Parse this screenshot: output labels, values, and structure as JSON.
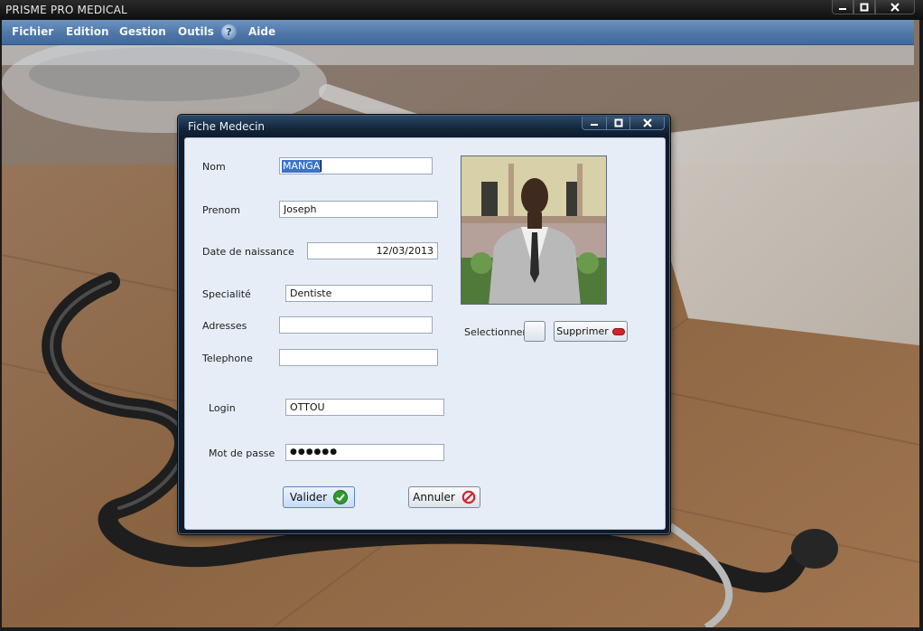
{
  "app": {
    "title": "PRISME PRO MEDICAL",
    "window_controls": [
      "minimize-icon",
      "maximize-icon",
      "close-icon"
    ]
  },
  "menu": {
    "items": [
      "Fichier",
      "Edition",
      "Gestion",
      "Outils",
      "Aide"
    ],
    "help_badge": "?"
  },
  "dialog": {
    "title": "Fiche Medecin",
    "fields": {
      "nom": {
        "label": "Nom",
        "value": "MANGA"
      },
      "prenom": {
        "label": "Prenom",
        "value": "Joseph"
      },
      "date_naissance": {
        "label": "Date de naissance",
        "value": "12/03/2013"
      },
      "specialite": {
        "label": "Specialité",
        "value": "Dentiste"
      },
      "adresses": {
        "label": "Adresses",
        "value": ""
      },
      "telephone": {
        "label": "Telephone",
        "value": ""
      },
      "login": {
        "label": "Login",
        "value": "OTTOU"
      },
      "mot_de_passe": {
        "label": "Mot de passe",
        "value": "●●●●●●"
      }
    },
    "photo": {
      "selectionner_label": "Selectionner",
      "supprimer_label": "Supprimer"
    },
    "buttons": {
      "valider": "Valider",
      "annuler": "Annuler"
    },
    "colors": {
      "valider_icon": "#2e9a2e",
      "annuler_icon": "#d4242a",
      "supprimer_icon": "#d4242a"
    }
  }
}
